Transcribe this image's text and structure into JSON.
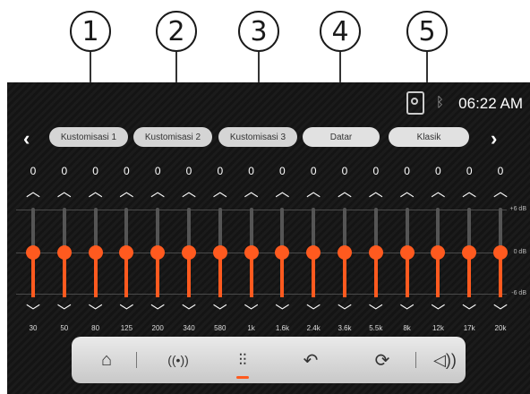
{
  "callouts": [
    "1",
    "2",
    "3",
    "4",
    "5"
  ],
  "status": {
    "time": "06:22 AM",
    "bluetooth_icon": "bluetooth-icon",
    "phone_icon": "phone-link-icon"
  },
  "presets": [
    "Kustomisasi 1",
    "Kustomisasi 2",
    "Kustomisasi 3",
    "Datar",
    "Klasik"
  ],
  "nav_arrows": {
    "prev": "‹",
    "next": "›"
  },
  "bands": [
    {
      "freq": "30",
      "value": "0",
      "level": 0
    },
    {
      "freq": "50",
      "value": "0",
      "level": 0
    },
    {
      "freq": "80",
      "value": "0",
      "level": 0
    },
    {
      "freq": "125",
      "value": "0",
      "level": 0
    },
    {
      "freq": "200",
      "value": "0",
      "level": 0
    },
    {
      "freq": "340",
      "value": "0",
      "level": 0
    },
    {
      "freq": "580",
      "value": "0",
      "level": 0
    },
    {
      "freq": "1k",
      "value": "0",
      "level": 0
    },
    {
      "freq": "1.6k",
      "value": "0",
      "level": 0
    },
    {
      "freq": "2.4k",
      "value": "0",
      "level": 0
    },
    {
      "freq": "3.6k",
      "value": "0",
      "level": 0
    },
    {
      "freq": "5.5k",
      "value": "0",
      "level": 0
    },
    {
      "freq": "8k",
      "value": "0",
      "level": 0
    },
    {
      "freq": "12k",
      "value": "0",
      "level": 0
    },
    {
      "freq": "17k",
      "value": "0",
      "level": 0
    },
    {
      "freq": "20k",
      "value": "0",
      "level": 0
    }
  ],
  "db_labels": {
    "top": "+6 dB",
    "mid": "0 dB",
    "bottom": "-6 dB"
  },
  "range_db": [
    -6,
    6
  ],
  "colors": {
    "accent": "#ff5a1f",
    "track": "#555555",
    "background": "#151515"
  },
  "bottom_nav": [
    {
      "name": "home-icon",
      "glyph": "⌂"
    },
    {
      "name": "radio-broadcast-icon",
      "glyph": "((•))"
    },
    {
      "name": "equalizer-icon",
      "glyph": "⫶"
    },
    {
      "name": "back-icon",
      "glyph": "↶"
    },
    {
      "name": "refresh-icon",
      "glyph": "⟳"
    },
    {
      "name": "volume-icon",
      "glyph": "🔊"
    }
  ]
}
